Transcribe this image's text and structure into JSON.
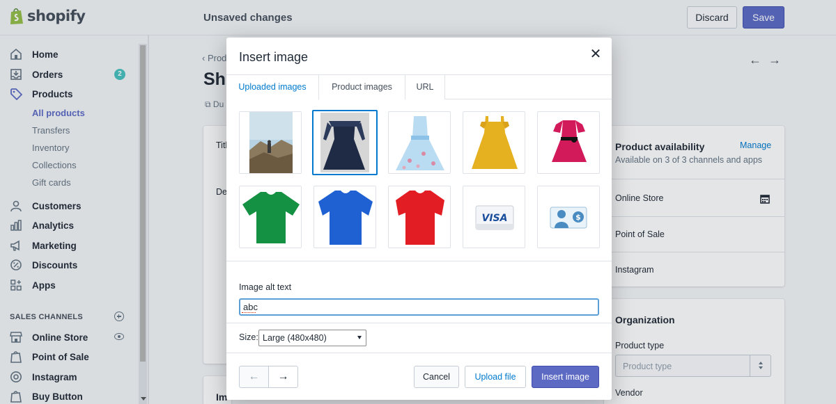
{
  "brand": {
    "name": "shopify",
    "accent": "#5c6ac4",
    "link": "#007ace",
    "badge": "#47c1bf"
  },
  "topbar": {
    "status": "Unsaved changes",
    "discard_label": "Discard",
    "save_label": "Save"
  },
  "sidebar": {
    "items": [
      {
        "label": "Home",
        "icon": "home-icon"
      },
      {
        "label": "Orders",
        "icon": "orders-icon",
        "badge": "2"
      },
      {
        "label": "Products",
        "icon": "tag-icon"
      },
      {
        "label": "Customers",
        "icon": "person-icon"
      },
      {
        "label": "Analytics",
        "icon": "bar-chart-icon"
      },
      {
        "label": "Marketing",
        "icon": "megaphone-icon"
      },
      {
        "label": "Discounts",
        "icon": "discount-icon"
      },
      {
        "label": "Apps",
        "icon": "apps-icon"
      }
    ],
    "product_sub": [
      "All products",
      "Transfers",
      "Inventory",
      "Collections",
      "Gift cards"
    ],
    "channels_heading": "SALES CHANNELS",
    "channels": [
      {
        "label": "Online Store",
        "icon": "store-icon"
      },
      {
        "label": "Point of Sale",
        "icon": "pos-bag-icon"
      },
      {
        "label": "Instagram",
        "icon": "instagram-icon"
      },
      {
        "label": "Buy Button",
        "icon": "buy-button-icon"
      }
    ]
  },
  "main": {
    "breadcrumb": "Prod",
    "page_title": "Sho",
    "duplicate": "Du",
    "title_frag": "Titl",
    "desc_frag": "De",
    "images_frag": "Im",
    "availability": {
      "title": "Product availability",
      "manage": "Manage",
      "subtitle": "Available on 3 of 3 channels and apps",
      "channels": [
        "Online Store",
        "Point of Sale",
        "Instagram"
      ]
    },
    "organization": {
      "title": "Organization",
      "type_label": "Product type",
      "type_placeholder": "Product type",
      "vendor_label": "Vendor"
    }
  },
  "modal": {
    "title": "Insert image",
    "tabs": [
      "Uploaded images",
      "Product images",
      "URL"
    ],
    "images": [
      {
        "name": "mountain-hiker-image"
      },
      {
        "name": "navy-lace-dress-image"
      },
      {
        "name": "floral-blue-dress-image"
      },
      {
        "name": "yellow-dress-image"
      },
      {
        "name": "pink-dress-image"
      },
      {
        "name": "green-tshirt-image"
      },
      {
        "name": "blue-tshirt-image"
      },
      {
        "name": "red-tshirt-image"
      },
      {
        "name": "visa-card-image"
      },
      {
        "name": "payment-user-image"
      }
    ],
    "visa_text": "VISA",
    "alt_label": "Image alt text",
    "alt_value": "abc",
    "size_label": "Size:",
    "size_value": "Large (480x480)",
    "cancel_label": "Cancel",
    "upload_label": "Upload file",
    "insert_label": "Insert image"
  }
}
